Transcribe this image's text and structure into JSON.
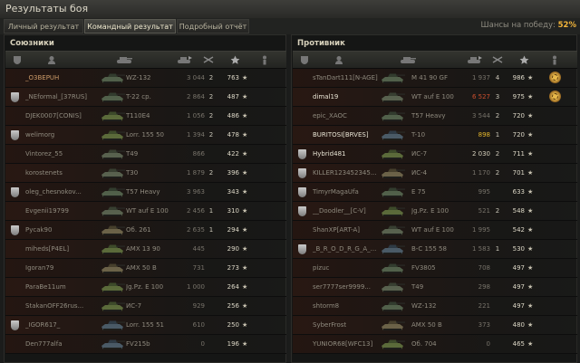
{
  "window": {
    "title": "Результаты боя"
  },
  "tabs": [
    {
      "label": "Личный результат"
    },
    {
      "label": "Командный результат"
    },
    {
      "label": "Подробный отчёт"
    }
  ],
  "win_chance": {
    "label": "Шансы на победу:",
    "value": "52%"
  },
  "allies": {
    "title": "Союзники",
    "header_icons": [
      "clan-icon",
      "player-icon",
      "tank-icon",
      "damage-icon",
      "kills-icon",
      "xp-star-icon",
      "status-icon"
    ],
    "rows": [
      {
        "name": "_O3BEPUH",
        "tank": "WZ-132",
        "damage": "3 044",
        "kills": "2",
        "xp": "763",
        "clan": false,
        "name_style": "orange",
        "damage_style": "dim"
      },
      {
        "name": "_NEformal_[37RUS]",
        "tank": "T-22 ср.",
        "damage": "2 864",
        "kills": "2",
        "xp": "487",
        "clan": true,
        "name_style": "dim",
        "damage_style": "dim"
      },
      {
        "name": "DJEK0007[CONIS]",
        "tank": "T110E4",
        "damage": "1 056",
        "kills": "2",
        "xp": "486",
        "clan": false,
        "name_style": "dim",
        "damage_style": "dim"
      },
      {
        "name": "welimorg",
        "tank": "Lorr. 155 50",
        "damage": "1 394",
        "kills": "2",
        "xp": "478",
        "clan": true,
        "name_style": "dim",
        "damage_style": "dim"
      },
      {
        "name": "Vintorez_55",
        "tank": "T49",
        "damage": "866",
        "kills": "",
        "xp": "422",
        "clan": false,
        "name_style": "dim",
        "damage_style": "dim"
      },
      {
        "name": "korostenets",
        "tank": "T30",
        "damage": "1 879",
        "kills": "2",
        "xp": "396",
        "clan": false,
        "name_style": "dim",
        "damage_style": "dim"
      },
      {
        "name": "oleg_chesnokov...",
        "tank": "T57 Heavy",
        "damage": "3 963",
        "kills": "",
        "xp": "343",
        "clan": true,
        "name_style": "dim",
        "damage_style": "dim"
      },
      {
        "name": "Evgenii19799",
        "tank": "WT auf E 100",
        "damage": "2 456",
        "kills": "1",
        "xp": "310",
        "clan": false,
        "name_style": "dim",
        "damage_style": "dim"
      },
      {
        "name": "Pycak90",
        "tank": "Об. 261",
        "damage": "2 635",
        "kills": "1",
        "xp": "294",
        "clan": true,
        "name_style": "dim",
        "damage_style": "dim"
      },
      {
        "name": "miheds[P4EL]",
        "tank": "AMX 13 90",
        "damage": "445",
        "kills": "",
        "xp": "290",
        "clan": false,
        "name_style": "dim",
        "damage_style": "dim"
      },
      {
        "name": "Igoran79",
        "tank": "AMX 50 B",
        "damage": "731",
        "kills": "",
        "xp": "273",
        "clan": false,
        "name_style": "dim",
        "damage_style": "dim"
      },
      {
        "name": "ParaBe11um",
        "tank": "Jg.Pz. E 100",
        "damage": "1 000",
        "kills": "",
        "xp": "264",
        "clan": false,
        "name_style": "dim",
        "damage_style": "dim"
      },
      {
        "name": "StakanOFF26rus...",
        "tank": "ИС-7",
        "damage": "929",
        "kills": "",
        "xp": "256",
        "clan": false,
        "name_style": "dim",
        "damage_style": "dim"
      },
      {
        "name": "_IGOR617_",
        "tank": "Lorr. 155 51",
        "damage": "610",
        "kills": "",
        "xp": "250",
        "clan": true,
        "name_style": "dim",
        "damage_style": "dim"
      },
      {
        "name": "Den777alfa",
        "tank": "FV215b",
        "damage": "0",
        "kills": "",
        "xp": "196",
        "clan": false,
        "name_style": "dim",
        "damage_style": "dim"
      }
    ]
  },
  "enemies": {
    "title": "Противник",
    "header_icons": [
      "clan-icon",
      "player-icon",
      "tank-icon",
      "damage-icon",
      "kills-icon",
      "xp-star-icon",
      "status-icon"
    ],
    "rows": [
      {
        "name": "sTanDart111[N-AGE]",
        "tank": "M 41 90 GF",
        "damage": "1 937",
        "kills": "4",
        "xp": "986",
        "clan": false,
        "medal": true,
        "name_style": "dim",
        "damage_style": "dim"
      },
      {
        "name": "dimal19",
        "tank": "WT auf E 100",
        "damage": "6 527",
        "kills": "3",
        "xp": "975",
        "clan": false,
        "medal": true,
        "name_style": "bright",
        "damage_style": "red"
      },
      {
        "name": "epic_XAOC",
        "tank": "T57 Heavy",
        "damage": "3 544",
        "kills": "2",
        "xp": "720",
        "clan": false,
        "medal": false,
        "name_style": "dim",
        "damage_style": "dim"
      },
      {
        "name": "BURITOSI[BRVES]",
        "tank": "T-10",
        "damage": "898",
        "kills": "1",
        "xp": "720",
        "clan": false,
        "medal": false,
        "name_style": "bright",
        "damage_style": "yel"
      },
      {
        "name": "Hybrid481",
        "tank": "ИС-7",
        "damage": "2 030",
        "kills": "2",
        "xp": "711",
        "clan": true,
        "medal": false,
        "name_style": "bright",
        "damage_style": "hi"
      },
      {
        "name": "KILLER123452345...",
        "tank": "ИС-4",
        "damage": "1 170",
        "kills": "2",
        "xp": "701",
        "clan": true,
        "medal": false,
        "name_style": "dim",
        "damage_style": "dim"
      },
      {
        "name": "TimyrMagaUfa",
        "tank": "E 75",
        "damage": "995",
        "kills": "",
        "xp": "633",
        "clan": true,
        "medal": false,
        "name_style": "dim",
        "damage_style": "dim"
      },
      {
        "name": "__Doodler__[C-V]",
        "tank": "Jg.Pz. E 100",
        "damage": "521",
        "kills": "2",
        "xp": "548",
        "clan": true,
        "medal": false,
        "name_style": "dim",
        "damage_style": "dim"
      },
      {
        "name": "ShanXP[ART-A]",
        "tank": "WT auf E 100",
        "damage": "1 995",
        "kills": "",
        "xp": "542",
        "clan": false,
        "medal": false,
        "name_style": "dim",
        "damage_style": "dim"
      },
      {
        "name": "_B_R_O_D_R_G_A_...",
        "tank": "B-C 155 58",
        "damage": "1 583",
        "kills": "1",
        "xp": "530",
        "clan": true,
        "medal": false,
        "name_style": "dim",
        "damage_style": "dim"
      },
      {
        "name": "pizuc",
        "tank": "FV3805",
        "damage": "708",
        "kills": "",
        "xp": "497",
        "clan": false,
        "medal": false,
        "name_style": "dim",
        "damage_style": "dim"
      },
      {
        "name": "ser7777ser9999...",
        "tank": "T49",
        "damage": "298",
        "kills": "",
        "xp": "497",
        "clan": false,
        "medal": false,
        "name_style": "dim",
        "damage_style": "dim"
      },
      {
        "name": "shtorm8",
        "tank": "WZ-132",
        "damage": "221",
        "kills": "",
        "xp": "497",
        "clan": false,
        "medal": false,
        "name_style": "dim",
        "damage_style": "dim"
      },
      {
        "name": "SyberFrost",
        "tank": "AMX 50 B",
        "damage": "373",
        "kills": "",
        "xp": "480",
        "clan": false,
        "medal": false,
        "name_style": "dim",
        "damage_style": "dim"
      },
      {
        "name": "YUNIOR68[WFC13]",
        "tank": "Об. 704",
        "damage": "0",
        "kills": "",
        "xp": "465",
        "clan": false,
        "medal": false,
        "name_style": "dim",
        "damage_style": "dim"
      }
    ]
  },
  "colors": {
    "accent": "#f2b43a",
    "damage_red": "#c94e2e",
    "damage_yellow": "#e4b72c"
  }
}
